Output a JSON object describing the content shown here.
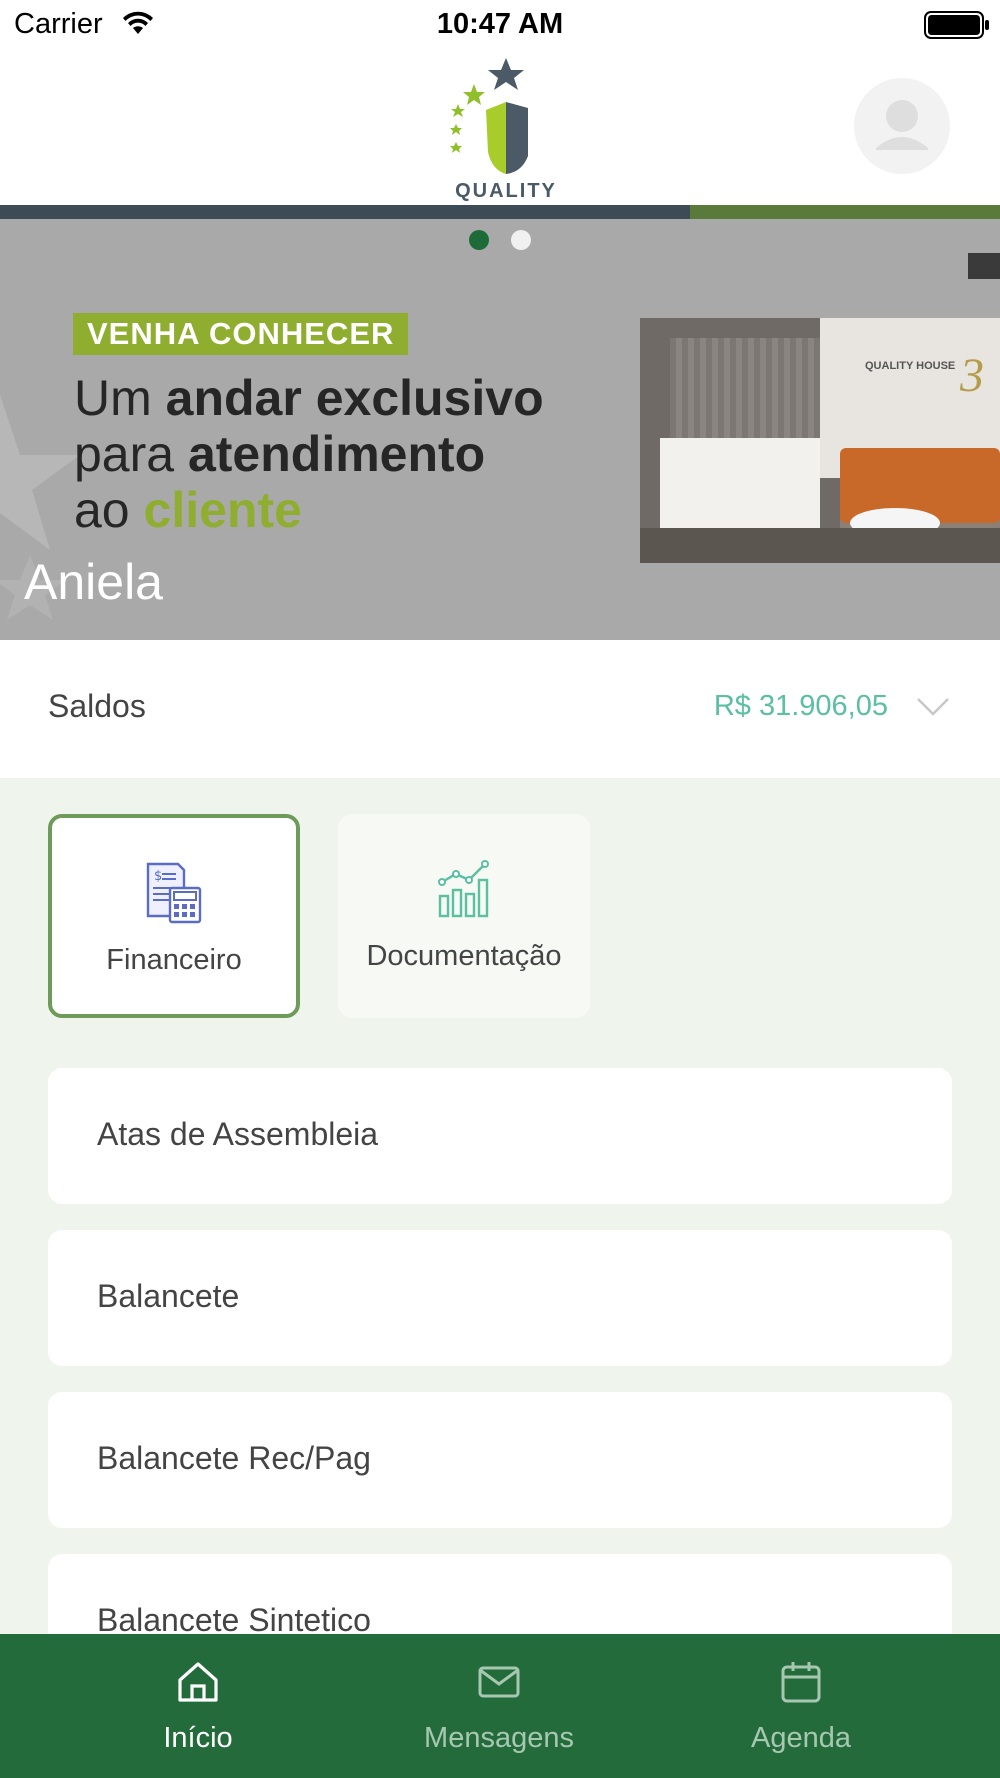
{
  "status_bar": {
    "carrier": "Carrier",
    "time": "10:47 AM"
  },
  "header": {
    "logo_text": "QUALITY HOUSE",
    "avatar_icon": "user-avatar-icon"
  },
  "banner": {
    "tag": "VENHA CONHECER",
    "line1_a": "Um ",
    "line1_b": "andar exclusivo",
    "line2_a": "para ",
    "line2_b": "atendimento",
    "line3_a": "ao ",
    "line3_b": "cliente",
    "photo_logo": "QUALITY HOUSE",
    "photo_number": "3",
    "name": "Aniela",
    "slide_active": 1,
    "slide_count": 2
  },
  "saldos": {
    "label": "Saldos",
    "value": "R$ 31.906,05"
  },
  "category_tabs": [
    {
      "label": "Financeiro",
      "icon": "calculator-invoice-icon",
      "active": true
    },
    {
      "label": "Documentação",
      "icon": "bar-chart-icon",
      "active": false
    }
  ],
  "documents": [
    {
      "label": "Atas de Assembleia"
    },
    {
      "label": "Balancete"
    },
    {
      "label": "Balancete Rec/Pag"
    },
    {
      "label": "Balancete Sintetico"
    }
  ],
  "tab_bar": [
    {
      "label": "Início",
      "icon": "home-icon",
      "active": true
    },
    {
      "label": "Mensagens",
      "icon": "mail-icon",
      "active": false
    },
    {
      "label": "Agenda",
      "icon": "calendar-icon",
      "active": false
    }
  ],
  "colors": {
    "primary": "#236b3b",
    "accent_green": "#8fae2f",
    "saldo_value": "#5bbfa2",
    "content_bg": "#eff5ec"
  }
}
